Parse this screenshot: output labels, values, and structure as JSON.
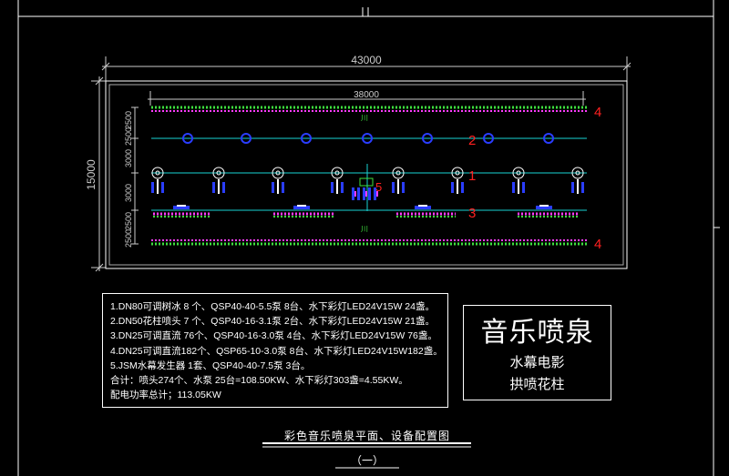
{
  "dimensions": {
    "outer_width": "43000",
    "inner_width": "38000",
    "total_height": "15000",
    "row_spacings": [
      "2500",
      "2500",
      "3000",
      "3000",
      "2500",
      "2500"
    ]
  },
  "row_markers": [
    "4",
    "2",
    "1",
    "5",
    "3",
    "4"
  ],
  "notes": [
    "1.DN80可调树冰 8 个、QSP40-40-5.5泵 8台、水下彩灯LED24V15W 24盏。",
    "2.DN50花柱喷头 7 个、QSP40-16-3.1泵 2台、水下彩灯LED24V15W 21盏。",
    "3.DN25可调直流 76个、QSP40-16-3.0泵 4台、水下彩灯LED24V15W 76盏。",
    "4.DN25可调直流182个、QSP65-10-3.0泵 8台、水下彩灯LED24V15W182盏。",
    "5.JSM水幕发生器 1套、QSP40-40-7.5泵 3台。",
    "合计：喷头274个、水泵 25台=108.50KW、水下彩灯303盏=4.55KW。",
    "配电功率总计；113.05KW"
  ],
  "title_block": {
    "main": "音乐喷泉",
    "line1": "水幕电影",
    "line2": "拱喷花柱"
  },
  "caption": "彩色音乐喷泉平面、设备配置图",
  "caption_number": "（一）",
  "colors": {
    "background": "#000000",
    "frame": "#ffffff",
    "dim": "#cccccc",
    "green_led": "#3ee03e",
    "magenta": "#ff3cff",
    "blue": "#2a3dff",
    "cyan": "#19d3d3",
    "marker_red": "#ff2020"
  }
}
